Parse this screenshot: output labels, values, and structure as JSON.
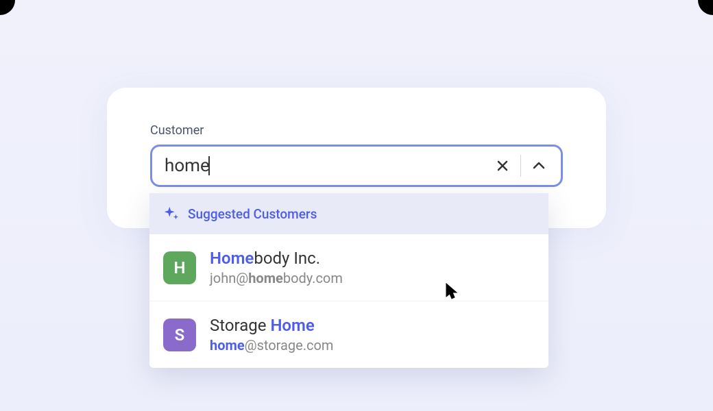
{
  "field": {
    "label": "Customer",
    "value": "home"
  },
  "dropdown": {
    "headerText": "Suggested Customers",
    "suggestions": [
      {
        "avatarLetter": "H",
        "avatarColor": "green",
        "nameHighlight": "Home",
        "nameRest": "body Inc.",
        "emailPrefix": "john@",
        "emailHighlight": "home",
        "emailRest": "body.com",
        "emailHighlightStyle": "bold"
      },
      {
        "avatarLetter": "S",
        "avatarColor": "purple",
        "namePrefix": "Storage ",
        "nameHighlight": "Home",
        "nameRest": "",
        "emailHighlight": "home",
        "emailRest": "@storage.com",
        "emailHighlightStyle": "blue"
      }
    ]
  }
}
